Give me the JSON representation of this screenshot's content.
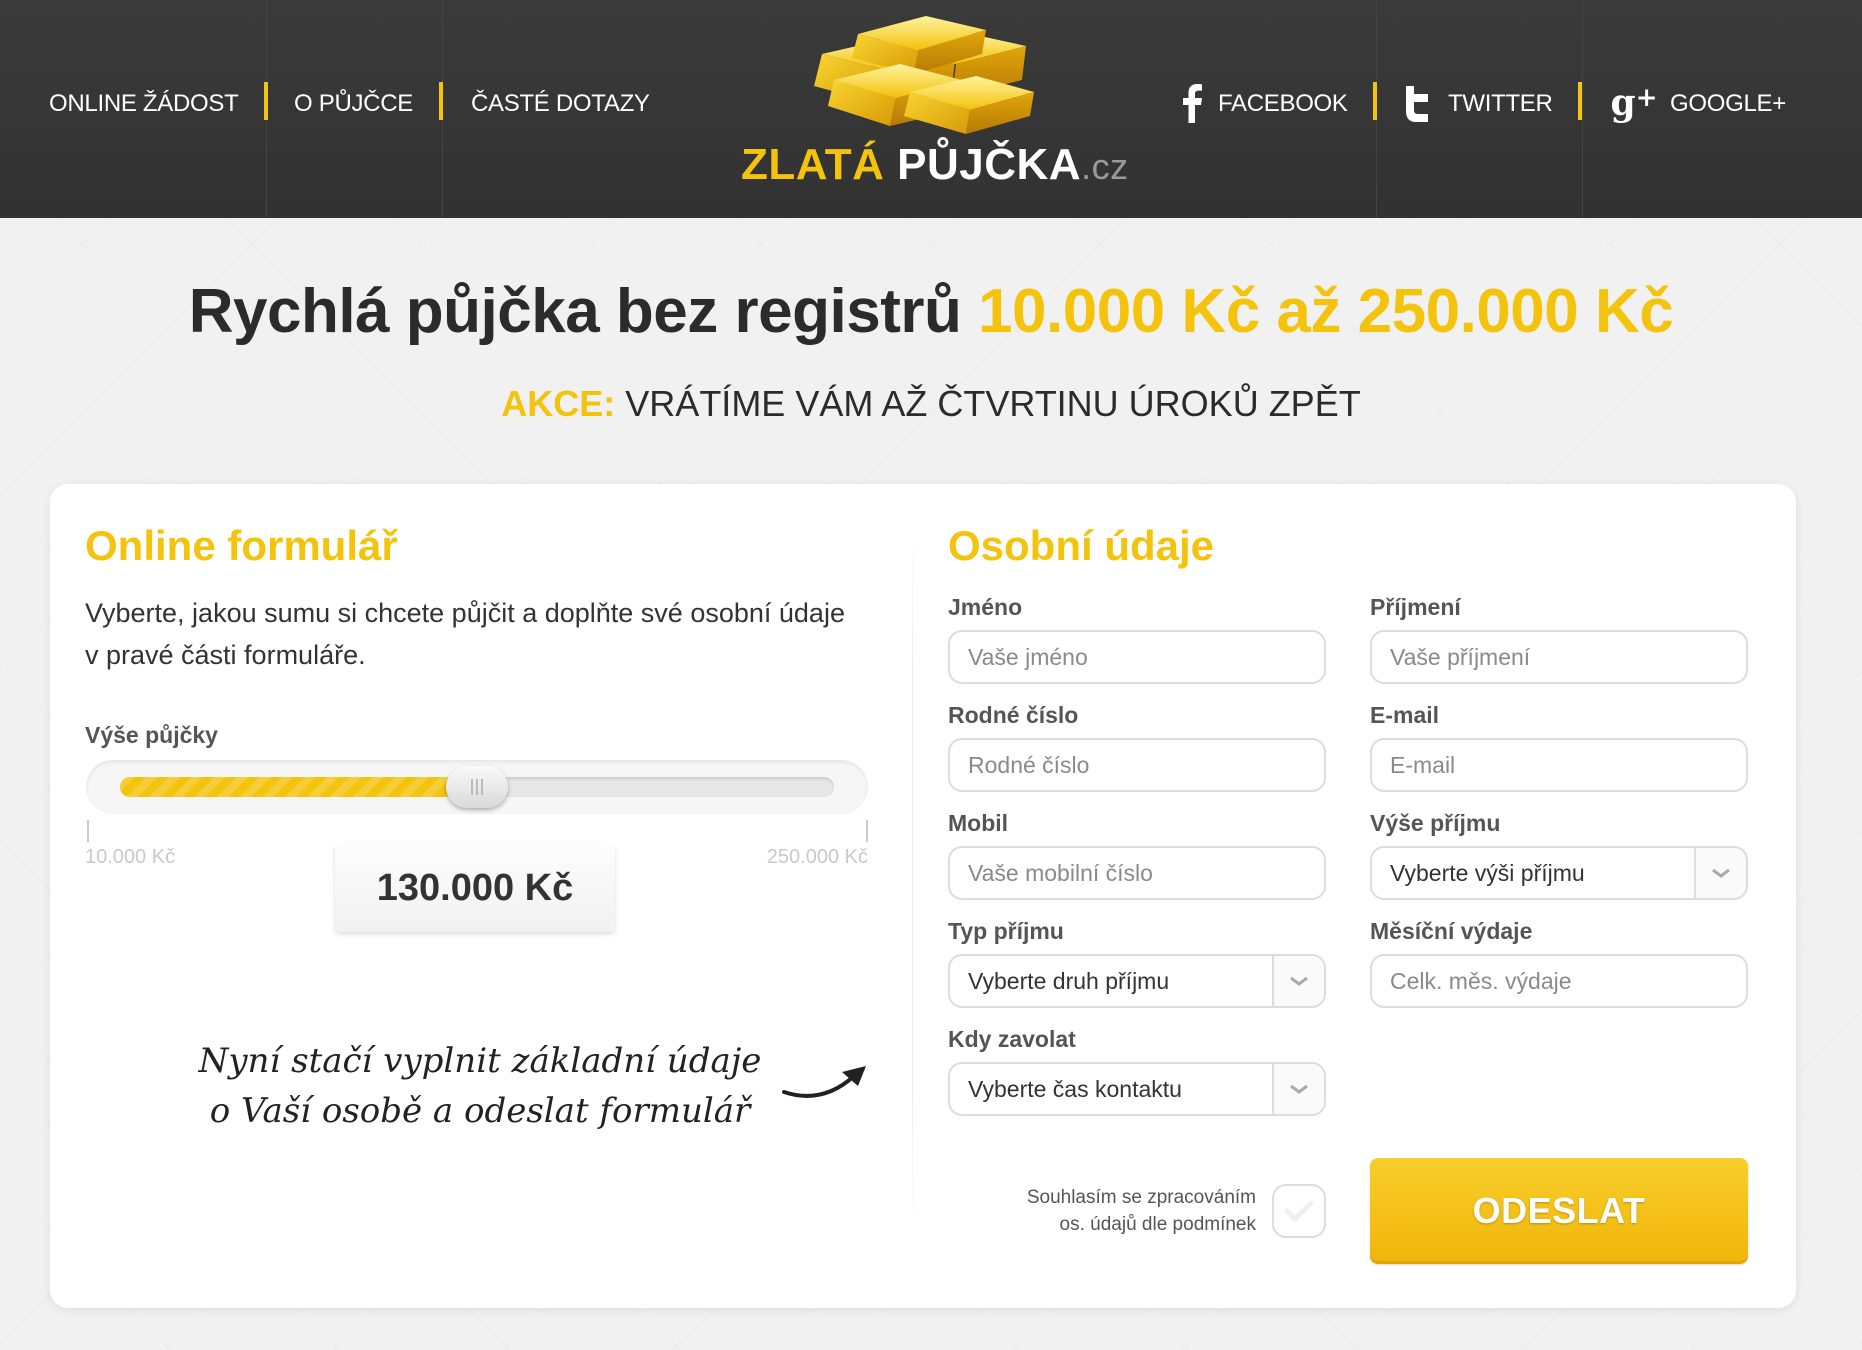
{
  "nav": {
    "left": [
      "ONLINE ŽÁDOST",
      "O PŮJČCE",
      "ČASTÉ DOTAZY"
    ],
    "right": [
      "FACEBOOK",
      "TWITTER",
      "GOOGLE+"
    ]
  },
  "logo": {
    "part1": "ZLATÁ",
    "part2": " PŮJČKA",
    "tld": ".cz"
  },
  "hero": {
    "title": "Rychlá půjčka bez registrů ",
    "title_highlight": "10.000 Kč až 250.000 Kč",
    "promo_prefix": "AKCE:",
    "promo_text": " VRÁTÍME VÁM AŽ ČTVRTINU ÚROKŮ ZPĚT"
  },
  "left_panel": {
    "title": "Online formulář",
    "description": "Vyberte, jakou sumu si chcete půjčit a doplňte své osobní údaje v pravé části formuláře.",
    "slider_label": "Výše půjčky",
    "min_label": "10.000 Kč",
    "max_label": "250.000 Kč",
    "amount": "130.000 Kč",
    "slider_fraction": 0.5,
    "note_line1": "Nyní stačí vyplnit základní údaje",
    "note_line2": "o Vaší osobě a odeslat formulář"
  },
  "form": {
    "title": "Osobní údaje",
    "jmeno_label": "Jméno",
    "jmeno_placeholder": "Vaše jméno",
    "prijmeni_label": "Příjmení",
    "prijmeni_placeholder": "Vaše příjmení",
    "rodne_label": "Rodné číslo",
    "rodne_placeholder": "Rodné číslo",
    "email_label": "E-mail",
    "email_placeholder": "E-mail",
    "mobil_label": "Mobil",
    "mobil_placeholder": "Vaše mobilní číslo",
    "vyse_label": "Výše příjmu",
    "vyse_value": "Vyberte výši příjmu",
    "typ_label": "Typ příjmu",
    "typ_value": "Vyberte druh příjmu",
    "vydaje_label": "Měsíční výdaje",
    "vydaje_placeholder": "Celk. měs. výdaje",
    "kdy_label": "Kdy zavolat",
    "kdy_value": "Vyberte čas kontaktu",
    "consent_line1": "Souhlasím se zpracováním",
    "consent_line2": "os. údajů dle podmínek",
    "submit": "ODESLAT"
  },
  "colors": {
    "accent": "#f4c30d",
    "header_bg": "#353535",
    "page_bg": "#f1f1f1"
  },
  "icons": [
    "facebook-icon",
    "twitter-icon",
    "google-plus-icon",
    "gold-bars-logo-icon",
    "chevron-down-icon",
    "check-icon",
    "curved-arrow-icon"
  ]
}
